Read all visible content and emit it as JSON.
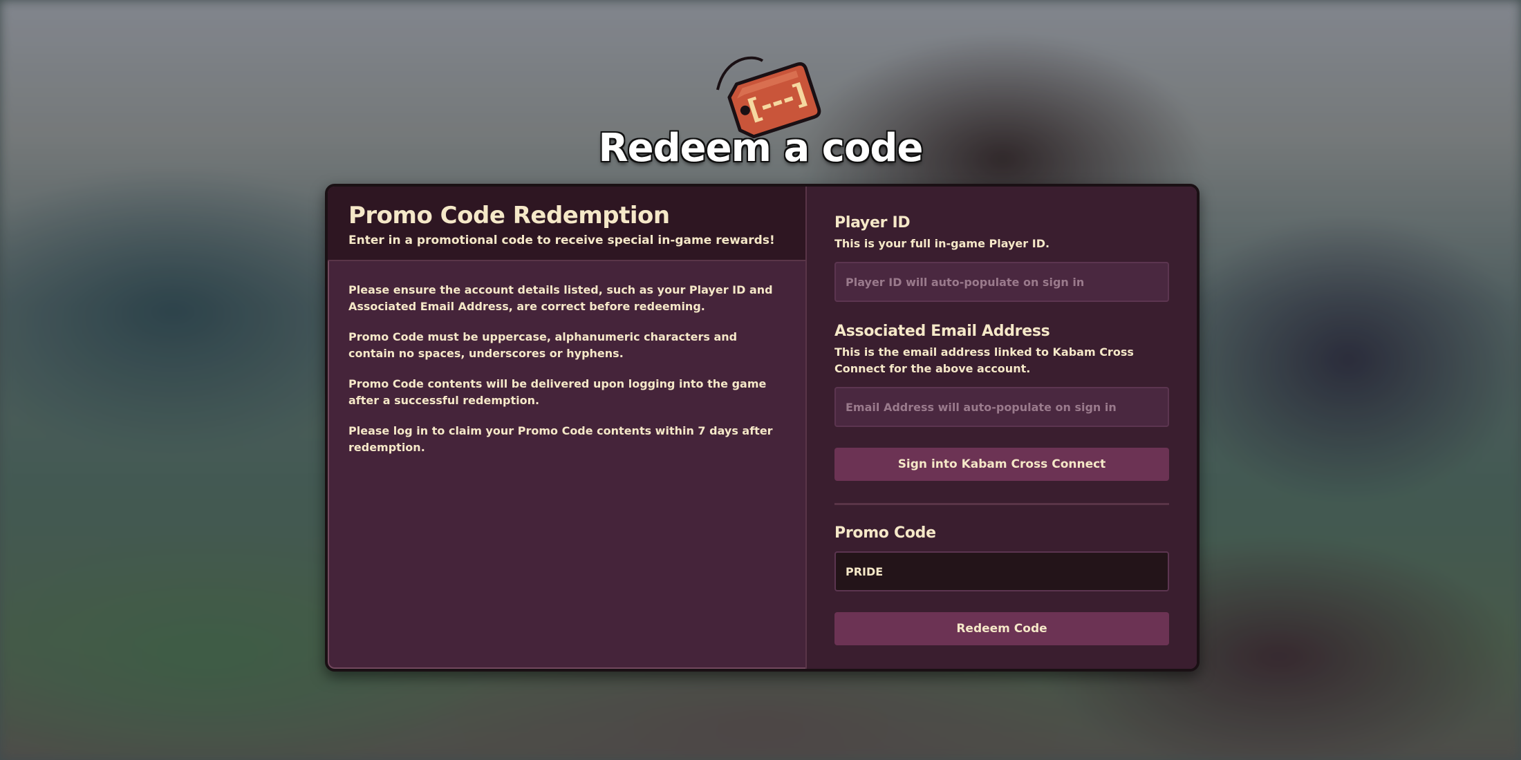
{
  "header": {
    "title": "Redeem a code",
    "tag_text": "[---]"
  },
  "info": {
    "title": "Promo Code Redemption",
    "subtitle": "Enter in a promotional code to receive special in-game rewards!",
    "paragraphs": [
      "Please ensure the account details listed, such as your Player ID and Associated Email Address, are correct before redeeming.",
      "Promo Code must be uppercase, alphanumeric characters and contain no spaces, underscores or hyphens.",
      "Promo Code contents will be delivered upon logging into the game after a successful redemption.",
      "Please log in to claim your Promo Code contents within 7 days after redemption."
    ]
  },
  "form": {
    "player_id": {
      "label": "Player ID",
      "description": "This is your full in-game Player ID.",
      "placeholder": "Player ID will auto-populate on sign in"
    },
    "email": {
      "label": "Associated Email Address",
      "description": "This is the email address linked to Kabam Cross Connect for the above account.",
      "placeholder": "Email Address will auto-populate on sign in"
    },
    "sign_in_label": "Sign into Kabam Cross Connect",
    "promo": {
      "label": "Promo Code",
      "value": "PRIDE"
    },
    "redeem_label": "Redeem Code"
  },
  "colors": {
    "panel": "#45243a",
    "panel_header": "#2e1622",
    "button": "#6c3354",
    "text": "#f5e8c8"
  }
}
